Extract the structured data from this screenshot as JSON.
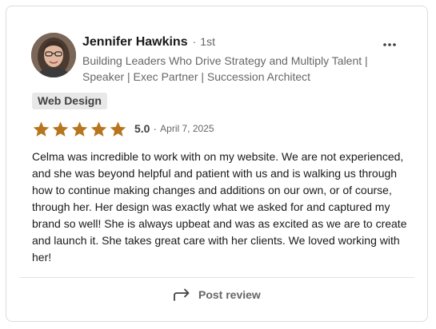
{
  "reviewer": {
    "name": "Jennifer Hawkins",
    "separator": "·",
    "degree": "1st",
    "headline": "Building Leaders Who Drive Strategy and Multiply Talent | Speaker | Exec Partner | Succession Architect",
    "avatar_icon": "profile-photo"
  },
  "menu": {
    "icon": "more-horizontal-icon"
  },
  "review": {
    "service_tag": "Web Design",
    "rating": 5.0,
    "rating_label": "5.0",
    "rating_max": 5,
    "separator": "·",
    "date": "April 7, 2025",
    "text": "Celma was incredible to work with on my website. We are not experienced, and she was beyond helpful and patient with us and is walking us through how to continue making changes and additions on our own, or of course, through her. Her design was exactly what we asked for and captured my brand so well! She is always upbeat and was as excited as we are to create and launch it. She takes great care with her clients. We loved working with her!"
  },
  "actions": {
    "post_review_label": "Post review",
    "post_review_icon": "share-arrow-icon"
  },
  "colors": {
    "star": "#b6751e",
    "tag_bg": "#e8e8e8",
    "border": "#dcdcdc",
    "muted_text": "#666666"
  }
}
